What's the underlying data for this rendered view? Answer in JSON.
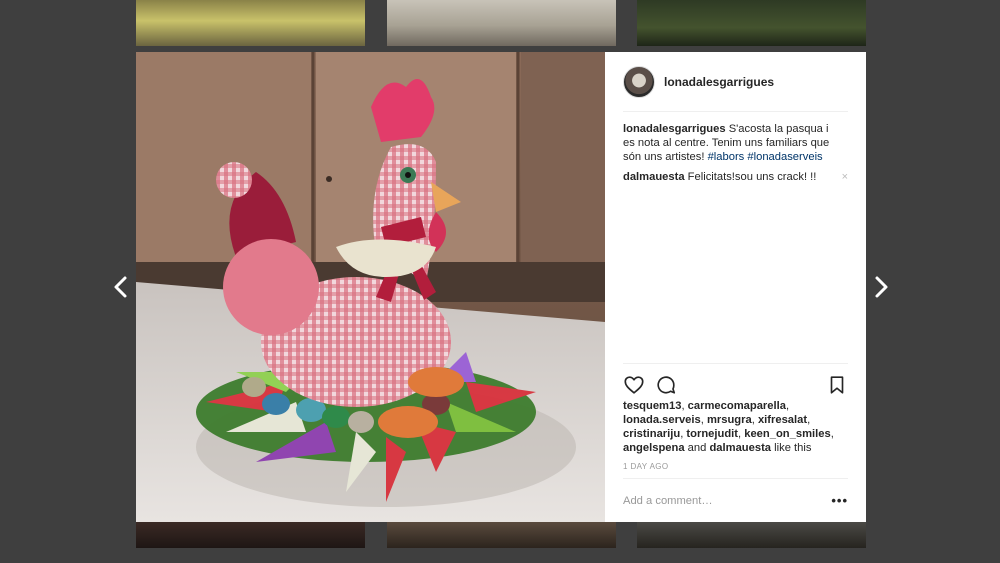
{
  "post": {
    "username": "lonadalesgarrigues",
    "caption": {
      "user": "lonadalesgarrigues",
      "text": "S'acosta la pasqua i es nota al centre. Tenim uns familiars que són uns artistes!",
      "hashtags": [
        "#labors",
        "#lonadaserveis"
      ]
    },
    "comments": [
      {
        "user": "dalmauesta",
        "text": "Felicitats!sou uns crack! !!",
        "close": "×"
      }
    ],
    "likes": {
      "users": [
        "tesquem13",
        "carmecomaparella",
        "lonada.serveis",
        "mrsugra",
        "xifresalat",
        "cristinariju",
        "tornejudit",
        "keen_on_smiles",
        "angelspena",
        "dalmauesta"
      ],
      "and_text": "and",
      "suffix": "like this"
    },
    "timestamp": "1 DAY AGO",
    "add_comment_placeholder": "Add a comment…",
    "more_label": "•••"
  },
  "icons": {
    "prev": "chevron-left-icon",
    "next": "chevron-right-icon",
    "like": "heart-icon",
    "comment": "comment-bubble-icon",
    "save": "bookmark-icon"
  },
  "colors": {
    "backdrop": "#3f3f3f",
    "hashtag": "#003569",
    "text": "#262626",
    "muted": "#999999"
  }
}
